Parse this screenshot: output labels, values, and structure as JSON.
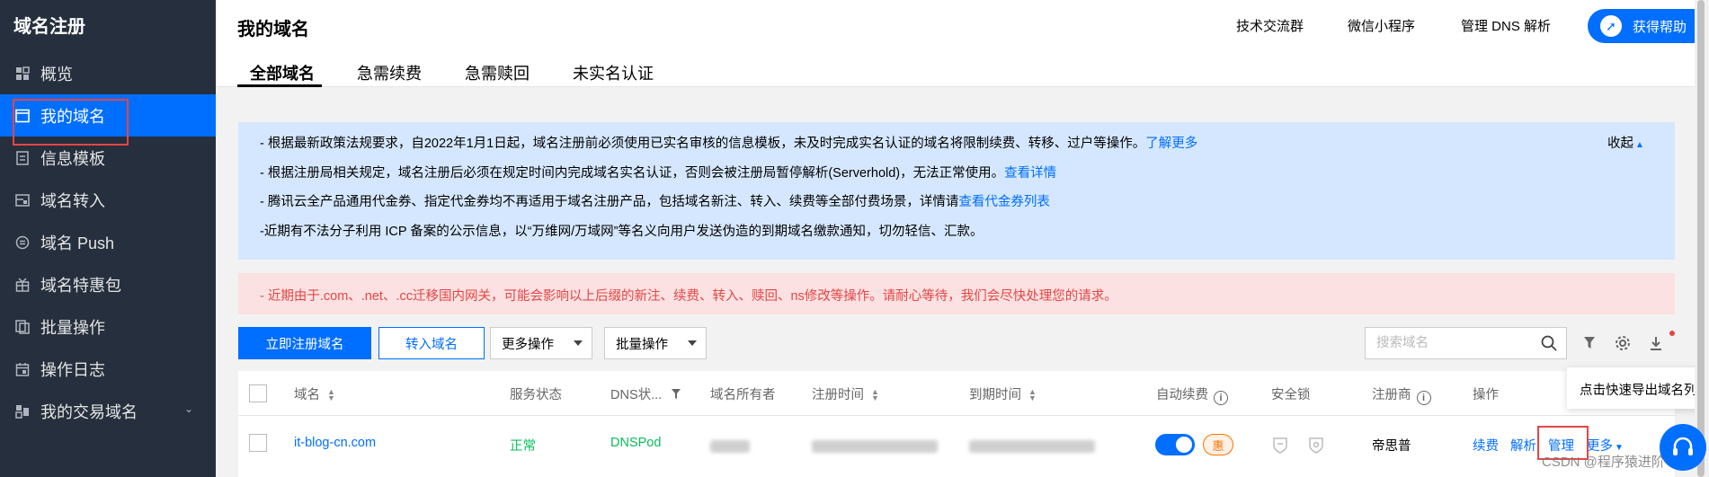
{
  "sidebar": {
    "title": "域名注册",
    "items": [
      {
        "label": "概览",
        "icon": "dashboard-icon"
      },
      {
        "label": "我的域名",
        "icon": "browser-window-icon",
        "active": true
      },
      {
        "label": "信息模板",
        "icon": "document-icon"
      },
      {
        "label": "域名转入",
        "icon": "transfer-in-icon"
      },
      {
        "label": "域名 Push",
        "icon": "push-icon"
      },
      {
        "label": "域名特惠包",
        "icon": "gift-icon"
      },
      {
        "label": "批量操作",
        "icon": "batch-copy-icon"
      },
      {
        "label": "操作日志",
        "icon": "calendar-icon"
      },
      {
        "label": "我的交易域名",
        "icon": "trade-icon",
        "expandable": true
      }
    ]
  },
  "header": {
    "title": "我的域名",
    "links": [
      "技术交流群",
      "微信小程序",
      "管理 DNS 解析"
    ],
    "help_button": "获得帮助",
    "tabs": [
      "全部域名",
      "急需续费",
      "急需赎回",
      "未实名认证"
    ],
    "active_tab": "全部域名"
  },
  "notice": {
    "collapse_label": "收起",
    "lines": [
      {
        "text": "- 根据最新政策法规要求，自2022年1月1日起，域名注册前必须使用已实名审核的信息模板，未及时完成实名认证的域名将限制续费、转移、过户等操作。",
        "link": "了解更多"
      },
      {
        "text": "- 根据注册局相关规定，域名注册后必须在规定时间内完成域名实名认证，否则会被注册局暂停解析(Serverhold)，无法正常使用。",
        "link": "查看详情"
      },
      {
        "text": "- 腾讯云全产品通用代金券、指定代金券均不再适用于域名注册产品，包括域名新注、转入、续费等全部付费场景，详情请",
        "link": "查看代金券列表"
      },
      {
        "text": "-近期有不法分子利用 ICP 备案的公示信息，以“万维网/万域网”等名义向用户发送伪造的到期域名缴款通知，切勿轻信、汇款。",
        "link": ""
      }
    ],
    "warning": "- 近期由于.com、.net、.cc迁移国内网关，可能会影响以上后缀的新注、续费、转入、赎回、ns修改等操作。请耐心等待，我们会尽快处理您的请求。"
  },
  "toolbar": {
    "register_button": "立即注册域名",
    "transfer_button": "转入域名",
    "more_ops_select": "更多操作",
    "batch_ops_select": "批量操作",
    "search_placeholder": "搜索域名"
  },
  "table": {
    "columns": [
      "域名",
      "服务状态",
      "DNS状...",
      "域名所有者",
      "注册时间",
      "到期时间",
      "自动续费",
      "安全锁",
      "注册商",
      "操作"
    ],
    "rows": [
      {
        "domain": "it-blog-cn.com",
        "status": "正常",
        "dns": "DNSPod",
        "registrar": "帝思普",
        "promo_badge": "惠",
        "auto_renew": true,
        "actions": [
          "续费",
          "解析",
          "管理",
          "更多"
        ]
      }
    ]
  },
  "popover": {
    "text": "点击快速导出域名列表"
  },
  "watermark": "CSDN @程序猿进阶",
  "colors": {
    "accent": "#006eff",
    "sidebar_bg": "#262f3d",
    "success": "#0abf5b",
    "danger": "#e54545",
    "notice_blue": "#d5e7ff",
    "notice_red": "#fbe1e1"
  }
}
